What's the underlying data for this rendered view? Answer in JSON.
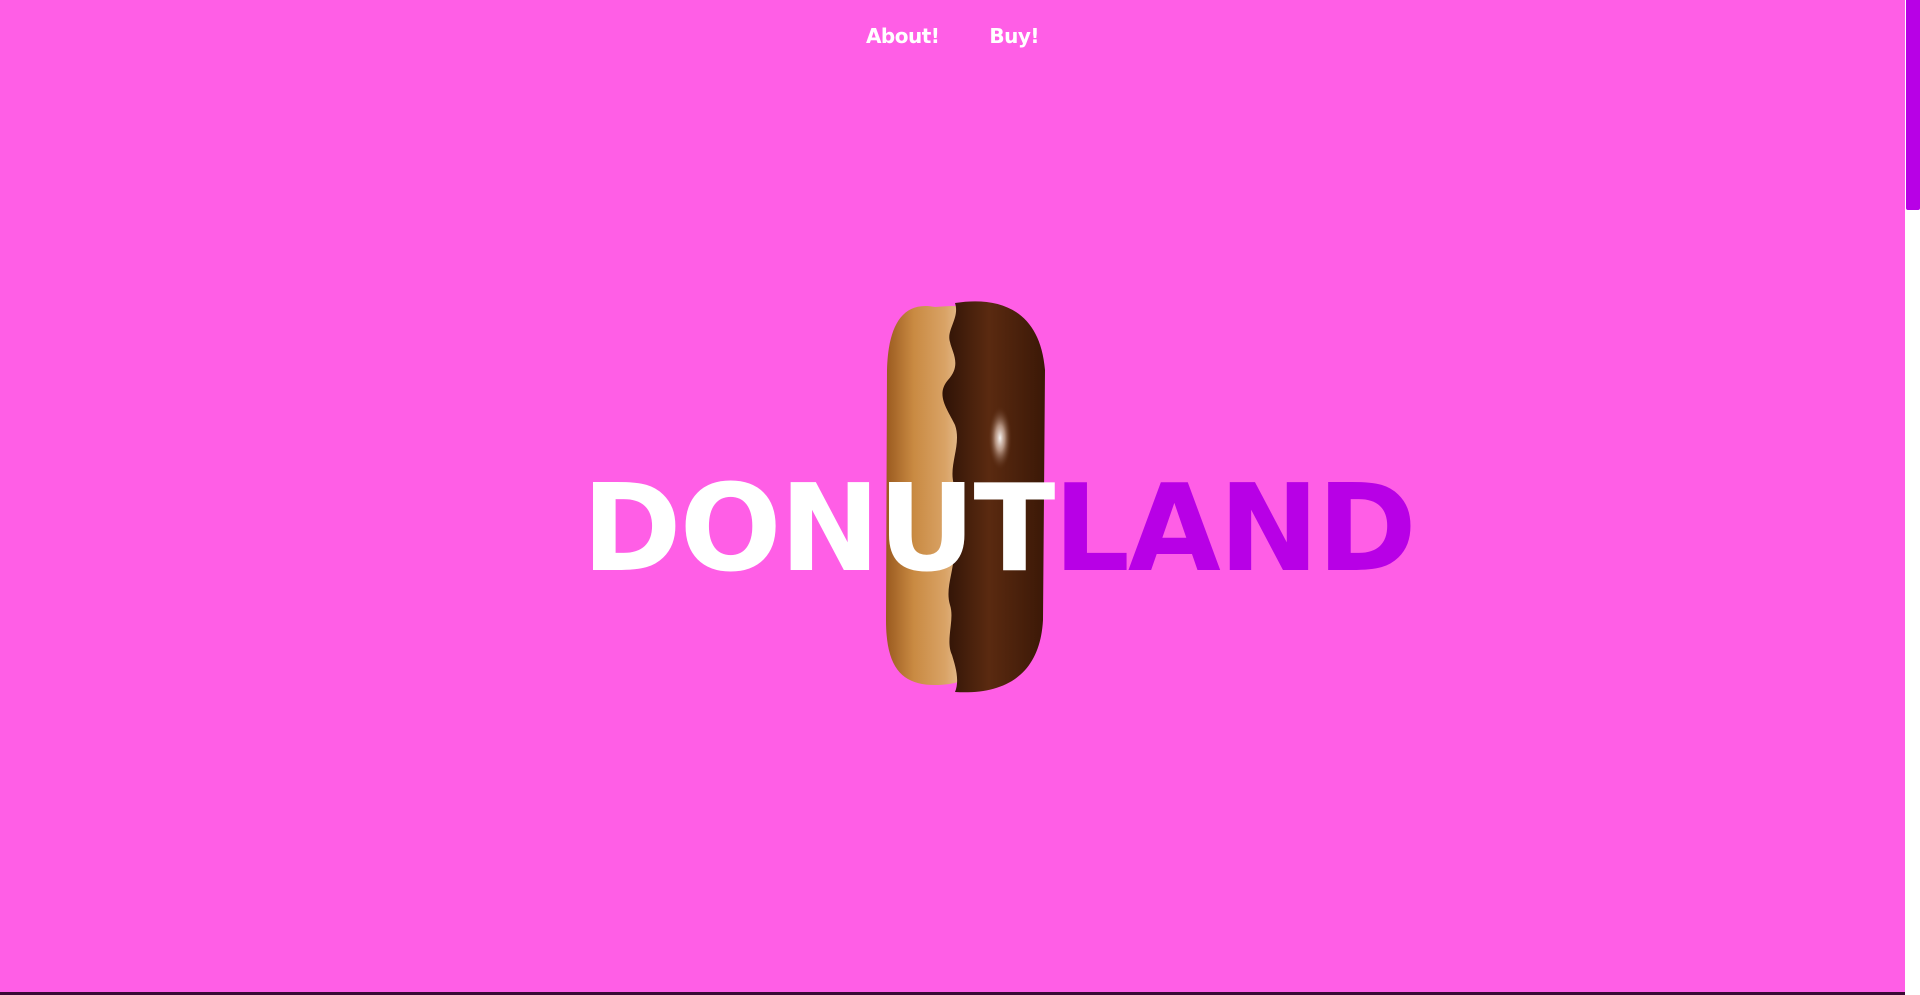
{
  "nav": {
    "items": [
      {
        "label": "About!"
      },
      {
        "label": "Buy!"
      }
    ]
  },
  "hero": {
    "title_part1": "DONUT",
    "title_part2": "LAND"
  },
  "colors": {
    "background": "#ff5ee6",
    "accent": "#b800e6",
    "nav_text": "#ffffff",
    "title_primary": "#ffffff",
    "donut_dough": "#c17a35",
    "donut_glaze": "#4a2010"
  },
  "icons": {
    "hero_image": "donut-icon"
  }
}
